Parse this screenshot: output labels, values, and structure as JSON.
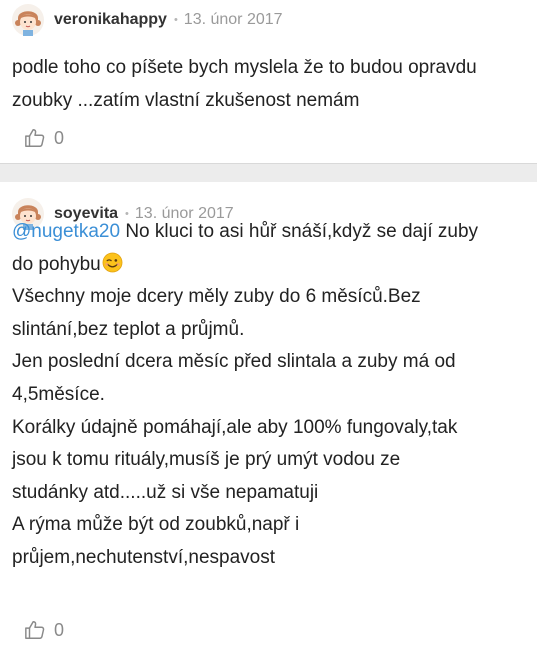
{
  "comments": [
    {
      "username": "veronikahappy",
      "separator": "•",
      "date": "13. únor 2017",
      "lines": [
        "podle toho co píšete bych myslela že to budou opravdu",
        "zoubky ...zatím vlastní zkušenost nemám"
      ],
      "likes": "0"
    },
    {
      "username": "soyevita",
      "separator": "•",
      "date": "13. únor 2017",
      "mention": "@nugetka20",
      "first_line_rest": " No kluci to asi hůř snáší,když se dají zuby",
      "second_line": "do pohybu",
      "lines": [
        "Všechny moje dcery měly zuby do 6 měsíců.Bez",
        "slintání,bez teplot a průjmů.",
        "Jen poslední dcera měsíc před slintala a zuby má od",
        "4,5měsíce.",
        "Korálky údajně pomáhají,ale aby 100% fungovaly,tak",
        "jsou k tomu rituály,musíš je prý umýt vodou ze",
        "studánky atd.....už si vše nepamatuji",
        "A rýma může být od zoubků,např i",
        "průjem,nechutenství,nespavost"
      ],
      "likes": "0"
    }
  ],
  "icons": {
    "avatar": "avatar-icon",
    "like": "thumbs-up-icon",
    "emoji": "winking-face-icon"
  },
  "colors": {
    "mention": "#3b8fd6",
    "divider": "#ececec",
    "meta": "#9a9a9a"
  }
}
